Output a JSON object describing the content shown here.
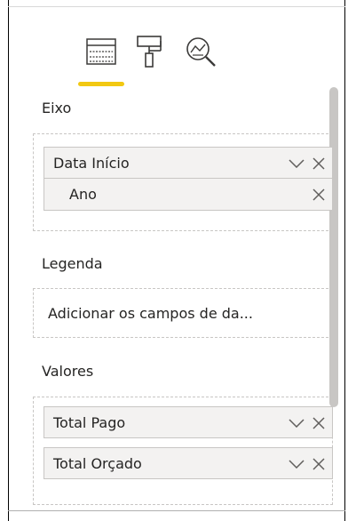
{
  "toolbar": {
    "icons": [
      {
        "name": "fields-icon",
        "active": true
      },
      {
        "name": "format-roller-icon",
        "active": false
      },
      {
        "name": "analytics-magnifier-icon",
        "active": false
      }
    ],
    "accent_color": "#f2c811"
  },
  "sections": {
    "axis": {
      "label": "Eixo",
      "field": {
        "label": "Data Início"
      },
      "sub_field": {
        "label": "Ano"
      }
    },
    "legend": {
      "label": "Legenda",
      "placeholder": "Adicionar os campos de da..."
    },
    "values": {
      "label": "Valores",
      "fields": [
        {
          "label": "Total Pago"
        },
        {
          "label": "Total Orçado"
        }
      ]
    }
  }
}
